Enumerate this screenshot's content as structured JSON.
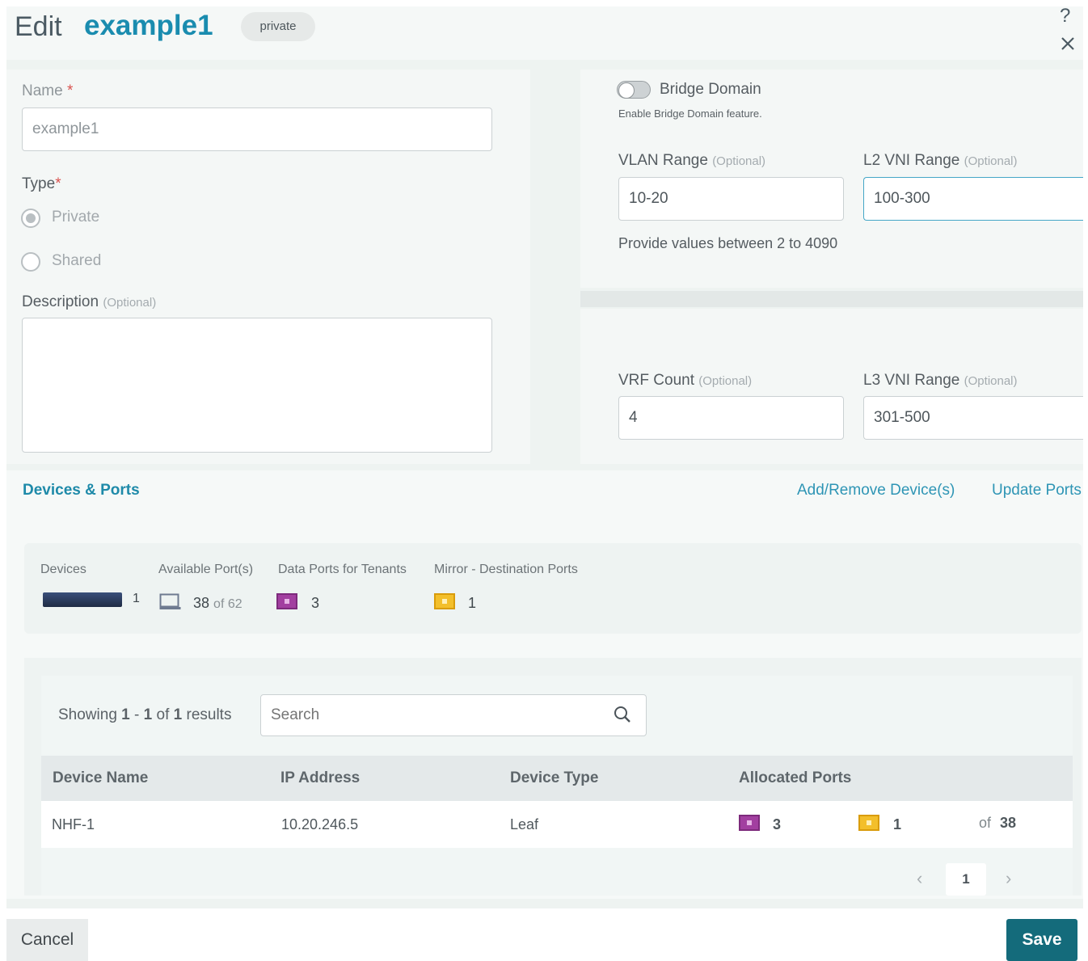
{
  "header": {
    "edit_label": "Edit",
    "name": "example1",
    "badge": "private",
    "help_icon": "?",
    "close_icon": "close-icon"
  },
  "left_form": {
    "name_label": "Name",
    "required_mark": "*",
    "name_value": "example1",
    "type_label": "Type",
    "type_options": [
      {
        "label": "Private",
        "selected": true
      },
      {
        "label": "Shared",
        "selected": false
      }
    ],
    "description_label": "Description",
    "optional_label": "(Optional)",
    "description_value": ""
  },
  "bridge": {
    "toggle_label": "Bridge Domain",
    "toggle_on": false,
    "toggle_hint": "Enable Bridge Domain feature.",
    "vlan_label": "VLAN Range",
    "vlan_value": "10-20",
    "vlan_hint": "Provide values between 2 to 4090",
    "l2vni_label": "L2 VNI Range",
    "l2vni_value": "100-300"
  },
  "vrf": {
    "vrf_label": "VRF Count",
    "vrf_value": "4",
    "l3vni_label": "L3 VNI Range",
    "l3vni_value": "301-500"
  },
  "devices": {
    "title": "Devices & Ports",
    "add_remove_link": "Add/Remove Device(s)",
    "update_ports_link": "Update Ports",
    "stats": {
      "devices_label": "Devices",
      "devices_count": "1",
      "available_label": "Available Port(s)",
      "available_value": "38",
      "available_of": "of 62",
      "data_ports_label": "Data Ports for Tenants",
      "data_ports_value": "3",
      "mirror_label": "Mirror - Destination Ports",
      "mirror_value": "1"
    },
    "showing": {
      "prefix": "Showing",
      "from": "1",
      "sep": "-",
      "to": "1",
      "of": "of",
      "total": "1",
      "suffix": "results"
    },
    "search_placeholder": "Search",
    "table": {
      "headers": [
        "Device Name",
        "IP Address",
        "Device Type",
        "Allocated Ports"
      ],
      "rows": [
        {
          "name": "NHF-1",
          "ip": "10.20.246.5",
          "type": "Leaf",
          "data_ports": "3",
          "mirror_ports": "1",
          "of_label": "of",
          "total": "38"
        }
      ]
    },
    "pagination": {
      "prev": "‹",
      "page": "1",
      "next": "›"
    }
  },
  "footer": {
    "cancel_label": "Cancel",
    "save_label": "Save"
  },
  "colors": {
    "accent": "#1a8caf",
    "save_button": "#146b7b",
    "data_port": "#a23fa0",
    "mirror_port": "#f3bf2b"
  }
}
